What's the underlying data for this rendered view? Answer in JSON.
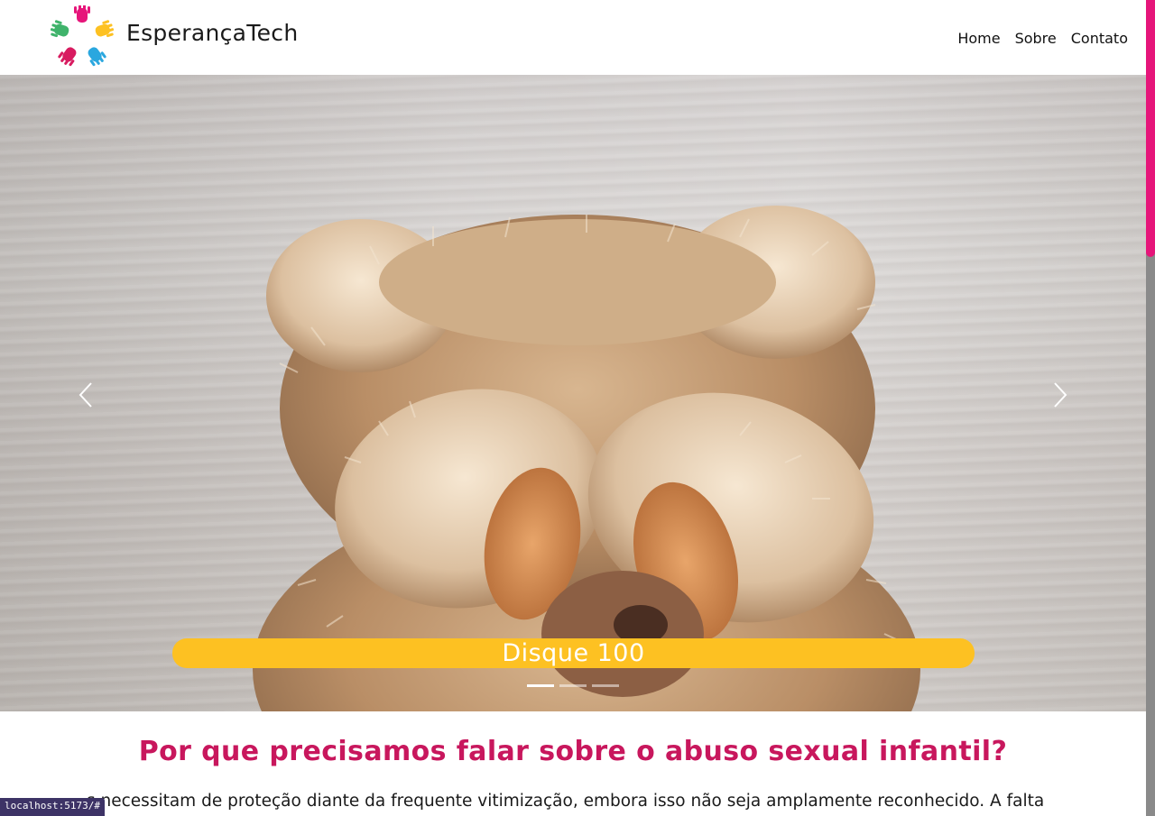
{
  "header": {
    "brand": "EsperançaTech",
    "nav": [
      "Home",
      "Sobre",
      "Contato"
    ]
  },
  "carousel": {
    "caption": "Disque 100",
    "indicator_count": 3,
    "active_index": 0
  },
  "content": {
    "title": "Por que precisamos falar sobre o abuso sexual infantil?",
    "paragraph_visible": "s necessitam de proteção diante da frequente vitimização, embora isso não seja amplamente reconhecido. A falta"
  },
  "status_bar": {
    "url": "localhost:5173/#"
  },
  "colors": {
    "accent": "#c8175d",
    "caption_bg": "#fdc122",
    "scroll_thumb": "#e6157a"
  },
  "icons": [
    "hands-logo-icon",
    "chevron-left-icon",
    "chevron-right-icon"
  ]
}
